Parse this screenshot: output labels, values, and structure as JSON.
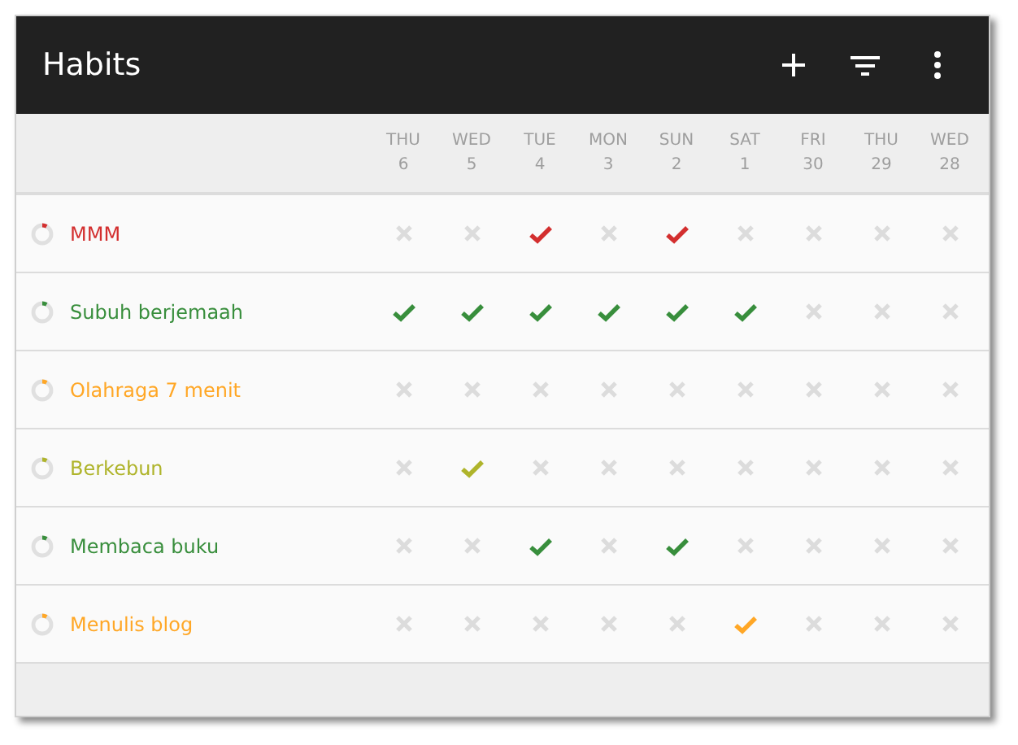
{
  "toolbar": {
    "title": "Habits"
  },
  "days": [
    {
      "weekday": "THU",
      "date": "6"
    },
    {
      "weekday": "WED",
      "date": "5"
    },
    {
      "weekday": "TUE",
      "date": "4"
    },
    {
      "weekday": "MON",
      "date": "3"
    },
    {
      "weekday": "SUN",
      "date": "2"
    },
    {
      "weekday": "SAT",
      "date": "1"
    },
    {
      "weekday": "FRI",
      "date": "30"
    },
    {
      "weekday": "THU",
      "date": "29"
    },
    {
      "weekday": "WED",
      "date": "28"
    }
  ],
  "habits": [
    {
      "name": "MMM",
      "color": "#d32f2f",
      "checks": [
        false,
        false,
        true,
        false,
        true,
        false,
        false,
        false,
        false
      ]
    },
    {
      "name": "Subuh berjemaah",
      "color": "#388e3c",
      "checks": [
        true,
        true,
        true,
        true,
        true,
        true,
        false,
        false,
        false
      ]
    },
    {
      "name": "Olahraga 7 menit",
      "color": "#ffa726",
      "checks": [
        false,
        false,
        false,
        false,
        false,
        false,
        false,
        false,
        false
      ]
    },
    {
      "name": "Berkebun",
      "color": "#afb42b",
      "checks": [
        false,
        true,
        false,
        false,
        false,
        false,
        false,
        false,
        false
      ]
    },
    {
      "name": "Membaca buku",
      "color": "#388e3c",
      "checks": [
        false,
        false,
        true,
        false,
        true,
        false,
        false,
        false,
        false
      ]
    },
    {
      "name": "Menulis blog",
      "color": "#ffa726",
      "checks": [
        false,
        false,
        false,
        false,
        false,
        true,
        false,
        false,
        false
      ]
    }
  ]
}
